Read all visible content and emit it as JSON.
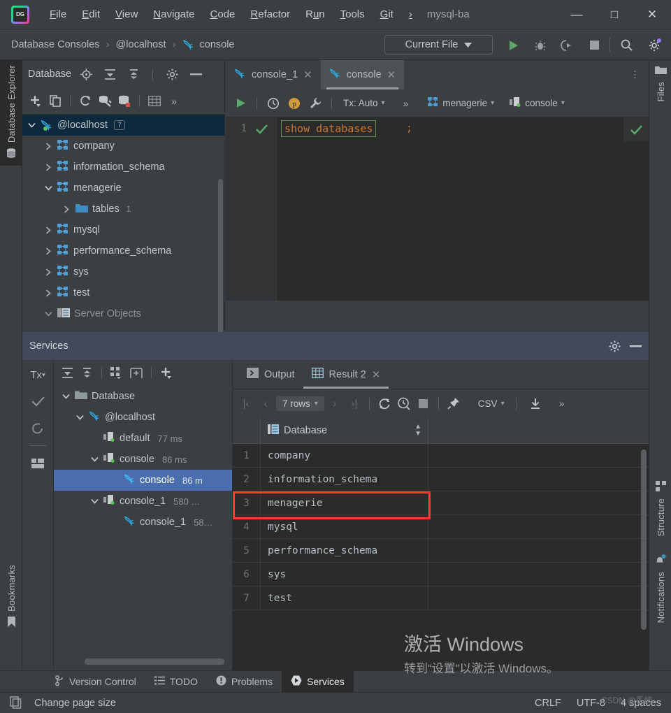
{
  "titlebar": {
    "menus": [
      {
        "label": "File",
        "mnemonic": "F"
      },
      {
        "label": "Edit",
        "mnemonic": "E"
      },
      {
        "label": "View",
        "mnemonic": "V"
      },
      {
        "label": "Navigate",
        "mnemonic": "N"
      },
      {
        "label": "Code",
        "mnemonic": "C"
      },
      {
        "label": "Refactor",
        "mnemonic": "R"
      },
      {
        "label": "Run",
        "mnemonic": "u"
      },
      {
        "label": "Tools",
        "mnemonic": "T"
      },
      {
        "label": "Git",
        "mnemonic": "G"
      },
      {
        "label": "›",
        "mnemonic": ""
      }
    ],
    "project_name": "mysql-ba",
    "minimize": "—",
    "maximize": "□",
    "close": "✕"
  },
  "navbar": {
    "breadcrumbs": [
      "Database Consoles",
      "@localhost",
      "console"
    ],
    "separator": "›",
    "run_config": "Current File",
    "icons": [
      "run-icon",
      "debug-icon",
      "run-coverage-icon",
      "stop-icon",
      "search-everywhere-icon",
      "settings-icon"
    ]
  },
  "left_stripe": {
    "top_tab": "Database Explorer",
    "bottom_tab": "Bookmarks"
  },
  "right_stripe": {
    "top_tab": "Files",
    "bottom_tabs": [
      "Structure",
      "Notifications"
    ]
  },
  "db_explorer": {
    "title": "Database",
    "header_icons": [
      "locate-icon",
      "expand-all-icon",
      "collapse-all-icon",
      "settings-icon",
      "hide-icon"
    ],
    "toolbar_icons": [
      "add-icon",
      "copy-icon",
      "refresh-icon",
      "db-tools-icon",
      "db-color-icon",
      "grid-icon",
      "more-icon"
    ],
    "tree": [
      {
        "label": "@localhost",
        "badge": "7",
        "indent": 0,
        "expanded": true,
        "icon": "mysql-icon",
        "selected": true
      },
      {
        "label": "company",
        "indent": 1,
        "expanded": false,
        "icon": "schema-icon"
      },
      {
        "label": "information_schema",
        "indent": 1,
        "expanded": false,
        "icon": "schema-icon"
      },
      {
        "label": "menagerie",
        "indent": 1,
        "expanded": true,
        "icon": "schema-icon"
      },
      {
        "label": "tables",
        "count": "1",
        "indent": 2,
        "expanded": false,
        "icon": "folder-icon"
      },
      {
        "label": "mysql",
        "indent": 1,
        "expanded": false,
        "icon": "schema-icon"
      },
      {
        "label": "performance_schema",
        "indent": 1,
        "expanded": false,
        "icon": "schema-icon"
      },
      {
        "label": "sys",
        "indent": 1,
        "expanded": false,
        "icon": "schema-icon"
      },
      {
        "label": "test",
        "indent": 1,
        "expanded": false,
        "icon": "schema-icon"
      },
      {
        "label": "Server Objects",
        "indent": 1,
        "expanded": true,
        "icon": "server-objects-icon"
      }
    ]
  },
  "editor": {
    "tabs": [
      {
        "label": "console_1",
        "active": false
      },
      {
        "label": "console",
        "active": true
      }
    ],
    "close_glyph": "✕",
    "more_glyph": "⋮",
    "toolbar": {
      "tx_label": "Tx: Auto",
      "more": "»",
      "schema": "menagerie",
      "session": "console",
      "icons": [
        "execute-icon",
        "history-icon",
        "params-icon",
        "wrench-icon"
      ]
    },
    "line_number": "1",
    "selected_sql": "show databases",
    "trailing_sql": ";"
  },
  "services": {
    "title": "Services",
    "header_icons": [
      "settings-icon",
      "hide-icon"
    ],
    "vtools": [
      "tx-icon",
      "commit-icon",
      "rollback-icon",
      "layout-icon"
    ],
    "tree_tools": [
      "expand-all-icon",
      "collapse-all-icon",
      "group-icon",
      "add-frame-icon",
      "add-icon"
    ],
    "tree": [
      {
        "label": "Database",
        "indent": 0,
        "expanded": true,
        "icon": "folder-icon"
      },
      {
        "label": "@localhost",
        "indent": 1,
        "expanded": true,
        "icon": "mysql-icon"
      },
      {
        "label": "default",
        "time": "77 ms",
        "indent": 2,
        "icon": "session-icon"
      },
      {
        "label": "console",
        "time": "86 ms",
        "indent": 2,
        "expanded": true,
        "icon": "session-icon"
      },
      {
        "label": "console",
        "time": "86 m",
        "indent": 3,
        "icon": "mysql-icon",
        "selected": true
      },
      {
        "label": "console_1",
        "time": "580 …",
        "indent": 2,
        "expanded": true,
        "icon": "session-icon"
      },
      {
        "label": "console_1",
        "time": "58…",
        "indent": 3,
        "icon": "mysql-icon"
      }
    ],
    "result_tabs": [
      {
        "label": "Output",
        "icon": "output-icon",
        "active": false
      },
      {
        "label": "Result 2",
        "icon": "table-icon",
        "active": true,
        "closeable": true
      }
    ],
    "grid_toolbar": {
      "first_page": "|‹",
      "prev_page": "‹",
      "rows_label": "7 rows",
      "next_page": "›",
      "last_page": "›|",
      "icons": [
        "refresh-icon",
        "query-time-icon",
        "stop-icon",
        "pin-icon",
        "download-icon",
        "more-icon"
      ],
      "format_label": "CSV"
    }
  },
  "chart_data": {
    "type": "table",
    "title": "Result 2",
    "columns": [
      "Database"
    ],
    "row_numbers": [
      "1",
      "2",
      "3",
      "4",
      "5",
      "6",
      "7"
    ],
    "rows": [
      [
        "company"
      ],
      [
        "information_schema"
      ],
      [
        "menagerie"
      ],
      [
        "mysql"
      ],
      [
        "performance_schema"
      ],
      [
        "sys"
      ],
      [
        "test"
      ]
    ],
    "highlighted_row_index": 2,
    "highlight_color": "#ff3b30",
    "row_count_label": "7 rows"
  },
  "watermark": {
    "line1": "激活 Windows",
    "line2": "转到“设置”以激活 Windows。",
    "signature": "CSDN @系统"
  },
  "toolwindow_bar": {
    "items": [
      {
        "label": "Version Control",
        "icon": "vcs-icon",
        "active": false
      },
      {
        "label": "TODO",
        "icon": "todo-icon",
        "active": false
      },
      {
        "label": "Problems",
        "icon": "problems-icon",
        "active": false
      },
      {
        "label": "Services",
        "icon": "services-icon",
        "active": true
      }
    ]
  },
  "statusbar": {
    "message": "Change page size",
    "icon": "page-icon",
    "right": [
      "CRLF",
      "UTF-8",
      "4 spaces"
    ]
  }
}
